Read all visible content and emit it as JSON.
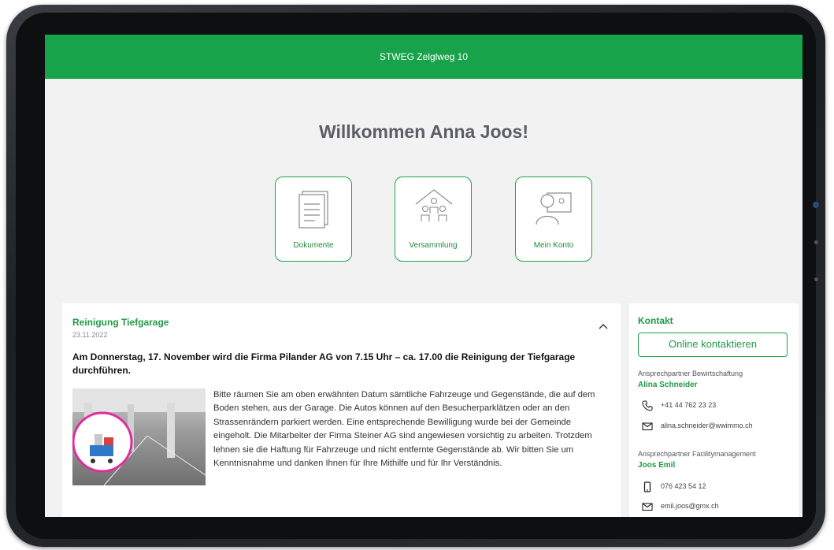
{
  "header": {
    "title": "STWEG Zelglweg 10"
  },
  "welcome": "Willkommen Anna Joos!",
  "tiles": [
    {
      "label": "Dokumente",
      "icon": "document-icon"
    },
    {
      "label": "Versammlung",
      "icon": "assembly-icon"
    },
    {
      "label": "Mein Konto",
      "icon": "account-icon"
    }
  ],
  "news": {
    "title": "Reinigung Tiefgarage",
    "date": "23.11.2022",
    "lead": "Am Donnerstag, 17. November wird die Firma Pilander AG von 7.15 Uhr – ca. 17.00 die Reinigung der Tiefgarage durchführen.",
    "body": "Bitte räumen Sie am oben erwähnten Datum sämtliche Fahrzeuge und Gegenstände, die auf dem Boden stehen, aus der Garage. Die Autos können auf den Besucherparklätzen oder an den Strassenrändern parkiert werden. Eine entsprechende Bewilligung wurde bei der Gemeinde eingeholt. Die Mitarbeiter der Firma Steiner AG sind angewiesen vorsichtig zu arbeiten. Trotzdem lehnen sie die Haftung für Fahrzeuge und nicht entfernte Gegenstände ab. Wir bitten Sie um Kenntnisnahme und danken Ihnen für Ihre Mithilfe und für Ihr Verständnis.",
    "collapse_icon": "chevron-up-icon"
  },
  "contact": {
    "title": "Kontakt",
    "button": "Online kontaktieren",
    "persons": [
      {
        "role": "Ansprechpartner Bewirtschaftung",
        "name": "Alina Schneider",
        "phone": "+41 44 762 23 23",
        "email": "alina.schneider@wwimmo.ch",
        "phone_icon": "phone-icon"
      },
      {
        "role": "Ansprechpartner Facilitymanagement",
        "name": "Joos Emil",
        "phone": "076 423 54 12",
        "email": "emil.joos@gmx.ch",
        "phone_icon": "mobile-phone-icon"
      }
    ]
  },
  "colors": {
    "brand": "#17a34a",
    "background": "#f2f2f2",
    "text": "#333333"
  }
}
